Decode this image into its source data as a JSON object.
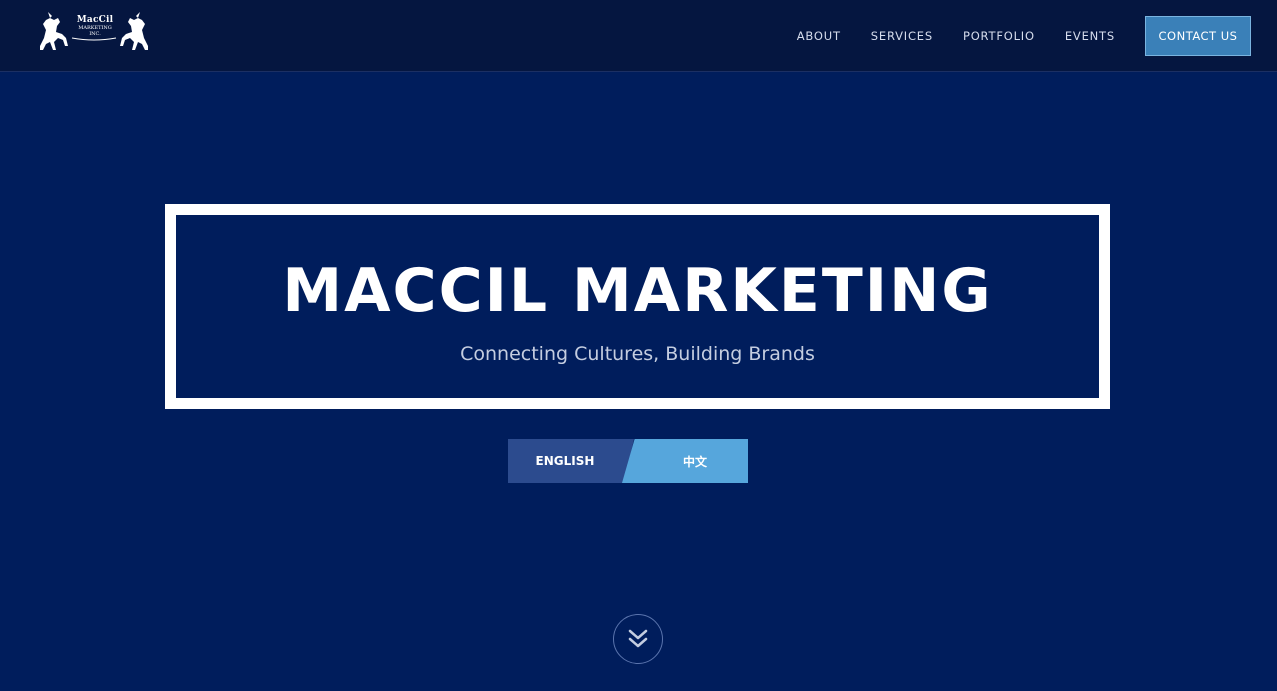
{
  "logo": {
    "name": "MacCil",
    "sub": "MARKETING",
    "inc": "INC.",
    "icon": "rearing-horses-icon"
  },
  "nav": {
    "items": [
      {
        "label": "ABOUT"
      },
      {
        "label": "SERVICES"
      },
      {
        "label": "PORTFOLIO"
      },
      {
        "label": "EVENTS"
      }
    ],
    "contact_label": "CONTACT US"
  },
  "hero": {
    "title": "MACCIL MARKETING",
    "tagline": "Connecting Cultures, Building Brands"
  },
  "language": {
    "english": "ENGLISH",
    "chinese": "中文"
  },
  "scroll": {
    "icon": "double-chevron-down-icon"
  },
  "colors": {
    "background": "#001d5c",
    "navbar": "#051640",
    "contact_button": "#3a80b8",
    "english_button": "#2c4b8e",
    "chinese_button": "#56a6dc",
    "frame": "#ffffff"
  }
}
